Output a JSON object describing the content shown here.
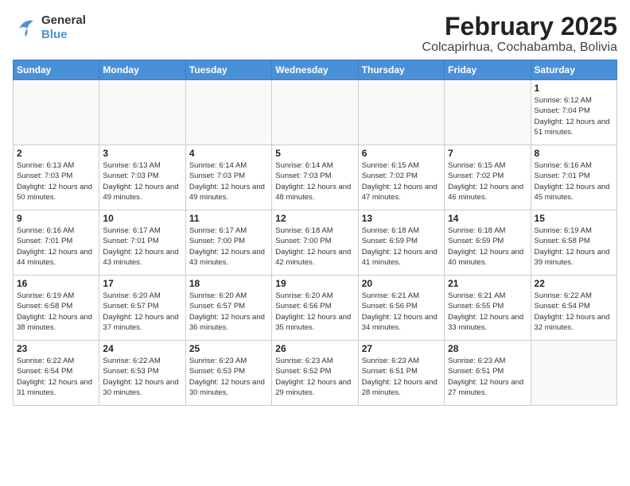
{
  "header": {
    "logo_general": "General",
    "logo_blue": "Blue",
    "month_title": "February 2025",
    "location": "Colcapirhua, Cochabamba, Bolivia"
  },
  "weekdays": [
    "Sunday",
    "Monday",
    "Tuesday",
    "Wednesday",
    "Thursday",
    "Friday",
    "Saturday"
  ],
  "weeks": [
    [
      {
        "day": "",
        "info": ""
      },
      {
        "day": "",
        "info": ""
      },
      {
        "day": "",
        "info": ""
      },
      {
        "day": "",
        "info": ""
      },
      {
        "day": "",
        "info": ""
      },
      {
        "day": "",
        "info": ""
      },
      {
        "day": "1",
        "info": "Sunrise: 6:12 AM\nSunset: 7:04 PM\nDaylight: 12 hours\nand 51 minutes."
      }
    ],
    [
      {
        "day": "2",
        "info": "Sunrise: 6:13 AM\nSunset: 7:03 PM\nDaylight: 12 hours\nand 50 minutes."
      },
      {
        "day": "3",
        "info": "Sunrise: 6:13 AM\nSunset: 7:03 PM\nDaylight: 12 hours\nand 49 minutes."
      },
      {
        "day": "4",
        "info": "Sunrise: 6:14 AM\nSunset: 7:03 PM\nDaylight: 12 hours\nand 49 minutes."
      },
      {
        "day": "5",
        "info": "Sunrise: 6:14 AM\nSunset: 7:03 PM\nDaylight: 12 hours\nand 48 minutes."
      },
      {
        "day": "6",
        "info": "Sunrise: 6:15 AM\nSunset: 7:02 PM\nDaylight: 12 hours\nand 47 minutes."
      },
      {
        "day": "7",
        "info": "Sunrise: 6:15 AM\nSunset: 7:02 PM\nDaylight: 12 hours\nand 46 minutes."
      },
      {
        "day": "8",
        "info": "Sunrise: 6:16 AM\nSunset: 7:01 PM\nDaylight: 12 hours\nand 45 minutes."
      }
    ],
    [
      {
        "day": "9",
        "info": "Sunrise: 6:16 AM\nSunset: 7:01 PM\nDaylight: 12 hours\nand 44 minutes."
      },
      {
        "day": "10",
        "info": "Sunrise: 6:17 AM\nSunset: 7:01 PM\nDaylight: 12 hours\nand 43 minutes."
      },
      {
        "day": "11",
        "info": "Sunrise: 6:17 AM\nSunset: 7:00 PM\nDaylight: 12 hours\nand 43 minutes."
      },
      {
        "day": "12",
        "info": "Sunrise: 6:18 AM\nSunset: 7:00 PM\nDaylight: 12 hours\nand 42 minutes."
      },
      {
        "day": "13",
        "info": "Sunrise: 6:18 AM\nSunset: 6:59 PM\nDaylight: 12 hours\nand 41 minutes."
      },
      {
        "day": "14",
        "info": "Sunrise: 6:18 AM\nSunset: 6:59 PM\nDaylight: 12 hours\nand 40 minutes."
      },
      {
        "day": "15",
        "info": "Sunrise: 6:19 AM\nSunset: 6:58 PM\nDaylight: 12 hours\nand 39 minutes."
      }
    ],
    [
      {
        "day": "16",
        "info": "Sunrise: 6:19 AM\nSunset: 6:58 PM\nDaylight: 12 hours\nand 38 minutes."
      },
      {
        "day": "17",
        "info": "Sunrise: 6:20 AM\nSunset: 6:57 PM\nDaylight: 12 hours\nand 37 minutes."
      },
      {
        "day": "18",
        "info": "Sunrise: 6:20 AM\nSunset: 6:57 PM\nDaylight: 12 hours\nand 36 minutes."
      },
      {
        "day": "19",
        "info": "Sunrise: 6:20 AM\nSunset: 6:56 PM\nDaylight: 12 hours\nand 35 minutes."
      },
      {
        "day": "20",
        "info": "Sunrise: 6:21 AM\nSunset: 6:56 PM\nDaylight: 12 hours\nand 34 minutes."
      },
      {
        "day": "21",
        "info": "Sunrise: 6:21 AM\nSunset: 6:55 PM\nDaylight: 12 hours\nand 33 minutes."
      },
      {
        "day": "22",
        "info": "Sunrise: 6:22 AM\nSunset: 6:54 PM\nDaylight: 12 hours\nand 32 minutes."
      }
    ],
    [
      {
        "day": "23",
        "info": "Sunrise: 6:22 AM\nSunset: 6:54 PM\nDaylight: 12 hours\nand 31 minutes."
      },
      {
        "day": "24",
        "info": "Sunrise: 6:22 AM\nSunset: 6:53 PM\nDaylight: 12 hours\nand 30 minutes."
      },
      {
        "day": "25",
        "info": "Sunrise: 6:23 AM\nSunset: 6:53 PM\nDaylight: 12 hours\nand 30 minutes."
      },
      {
        "day": "26",
        "info": "Sunrise: 6:23 AM\nSunset: 6:52 PM\nDaylight: 12 hours\nand 29 minutes."
      },
      {
        "day": "27",
        "info": "Sunrise: 6:23 AM\nSunset: 6:51 PM\nDaylight: 12 hours\nand 28 minutes."
      },
      {
        "day": "28",
        "info": "Sunrise: 6:23 AM\nSunset: 6:51 PM\nDaylight: 12 hours\nand 27 minutes."
      },
      {
        "day": "",
        "info": ""
      }
    ]
  ]
}
